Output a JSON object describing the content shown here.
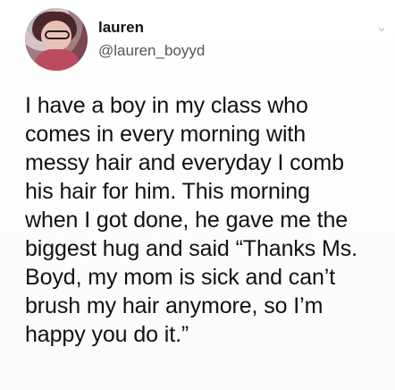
{
  "tweet": {
    "user": {
      "display_name": "lauren",
      "handle": "@lauren_boyyd"
    },
    "text": "I have a boy in my class who\ncomes in every morning with\nmessy hair and everyday I comb\nhis hair for him. This morning\nwhen I got done, he gave me the\nbiggest hug and said “Thanks Ms.\nBoyd, my mom is sick and can’t\nbrush my hair anymore, so I’m\nhappy you do it.”",
    "menu_icon": "chevron-down-icon"
  }
}
